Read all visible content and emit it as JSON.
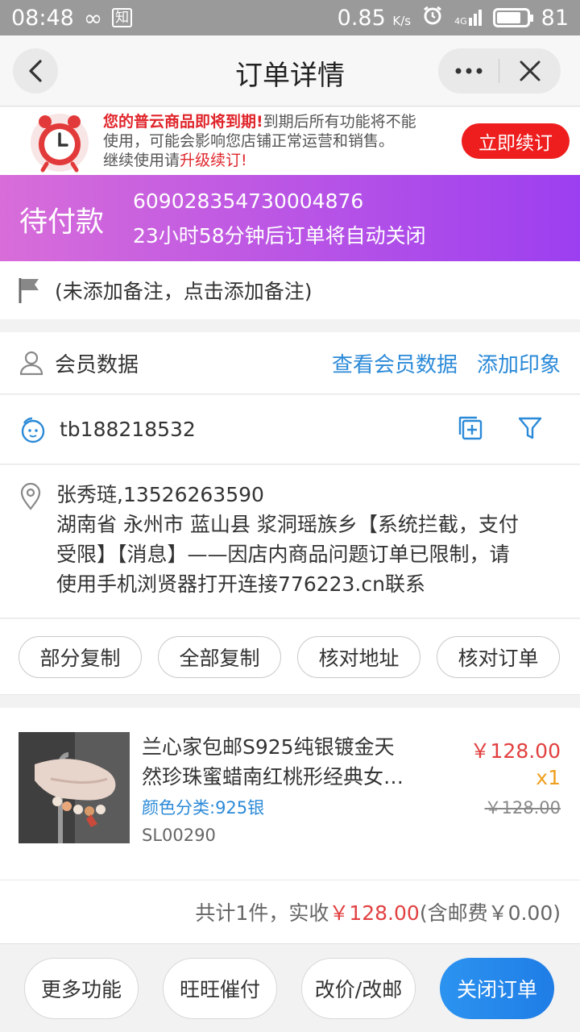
{
  "statusbar": {
    "time": "08:48",
    "app_badge": "知",
    "net_speed": "0.85",
    "net_unit": "K/s",
    "signal": "4G",
    "battery": "81",
    "battery_level": 0.81
  },
  "nav": {
    "title": "订单详情"
  },
  "banner": {
    "headline": "您的普云商品即将到期!",
    "line1_rest": "到期后所有功能将不能",
    "line2": "使用，可能会影响您店铺正常运营和销售。",
    "line3_prefix": "继续使用请",
    "line3_link": "升级续订!",
    "renew_label": "立即续订"
  },
  "order": {
    "state": "待付款",
    "order_no": "609028354730004876",
    "countdown": "23小时58分钟后订单将自动关闭"
  },
  "note": {
    "text": "(未添加备注，点击添加备注)"
  },
  "member": {
    "label": "会员数据",
    "view_link": "查看会员数据",
    "impression_link": "添加印象"
  },
  "buyer": {
    "id": "tb188218532"
  },
  "address": {
    "name_phone": "张秀琏,13526263590",
    "line1": "湖南省 永州市 蓝山县 浆洞瑶族乡【系统拦截，支付",
    "line2": "受限】【消息】——因店内商品问题订单已限制，请",
    "line3": "使用手机浏贤器打开连接776223.cn联系"
  },
  "copy_actions": [
    "部分复制",
    "全部复制",
    "核对地址",
    "核对订单"
  ],
  "product": {
    "title_line1": "兰心家包邮S925纯银镀金天",
    "title_line2": "然珍珠蜜蜡南红桃形经典女…",
    "spec": "颜色分类:925银",
    "sku": "SL00290",
    "price": "￥128.00",
    "qty": "x1",
    "orig_price": "￥128.00"
  },
  "total": {
    "prefix": "共计1件，实收",
    "amount": "￥128.00",
    "suffix": "(含邮费￥0.00)"
  },
  "bottom": {
    "more": "更多功能",
    "remind": "旺旺催付",
    "modify": "改价/改邮",
    "close": "关闭订单"
  },
  "colors": {
    "accent_blue": "#2b8ad8",
    "price_red": "#e24040",
    "header_gradient_start": "#d86dd9",
    "header_gradient_end": "#9c3ff0",
    "renew_red": "#ee1e1e"
  }
}
